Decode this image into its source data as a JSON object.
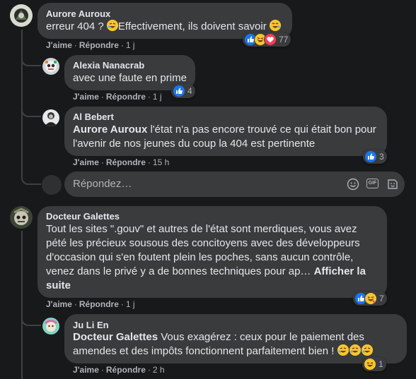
{
  "comments": [
    {
      "author": "Aurore Auroux",
      "text_before": "erreur 404 ? ",
      "text_after": "Effectivement, ils doivent savoir ",
      "actions": {
        "like": "J'aime",
        "reply": "Répondre",
        "time": "1 j"
      },
      "reactions": {
        "icons": [
          "like-icon",
          "haha-icon",
          "love-icon"
        ],
        "count": "77"
      }
    },
    {
      "author": "Alexia Nanacrab",
      "text": "avec une faute en prime",
      "actions": {
        "like": "J'aime",
        "reply": "Répondre",
        "time": "1 j"
      },
      "reactions": {
        "icons": [
          "like-icon"
        ],
        "count": "4"
      }
    },
    {
      "author": "Al Bebert",
      "mention": "Aurore Auroux",
      "text_line1": " l'état n'a pas encore trouvé ce qui était bon pour",
      "text_line2": "l'avenir de nos jeunes du coup la 404 est pertinente",
      "actions": {
        "like": "J'aime",
        "reply": "Répondre",
        "time": "15 h"
      },
      "reactions": {
        "icons": [
          "like-icon"
        ],
        "count": "3"
      }
    },
    {
      "author": "Docteur Galettes",
      "lines": [
        "Tout les sites \".gouv\" et autres de l'état sont merdiques, vous avez",
        "pété les précieux sousous des concitoyens avec des développeurs",
        "d'occasion qui s'en foutent plein les poches, sans aucun contrôle,",
        "venez dans le privé y a de bonnes techniques pour ap… "
      ],
      "see_more_1": "Afficher la",
      "see_more_2": "suite",
      "actions": {
        "like": "J'aime",
        "reply": "Répondre",
        "time": "1 j"
      },
      "reactions": {
        "icons": [
          "like-icon",
          "haha-icon"
        ],
        "count": "7"
      }
    },
    {
      "author": "Ju Li En",
      "mention": "Docteur Galettes",
      "text_line1": " Vous exagérez : ceux pour le paiement des",
      "text_line2": "amendes et des impôts fonctionnent parfaitement bien ! ",
      "actions": {
        "like": "J'aime",
        "reply": "Répondre",
        "time": "2 h"
      },
      "reactions": {
        "icons": [
          "haha-icon"
        ],
        "count": "1"
      }
    }
  ],
  "reply_box": {
    "placeholder": "Répondez…",
    "tools": [
      "emoji-icon",
      "camera-icon",
      "gif-icon",
      "sticker-icon"
    ],
    "gif_label": "GIF"
  },
  "colors": {
    "background": "#18191a",
    "bubble": "#3a3b3c",
    "text": "#e4e6eb",
    "secondary": "#b0b3b8",
    "like": "#1877f2",
    "love": "#f33e58",
    "haha": "#f7c531"
  }
}
